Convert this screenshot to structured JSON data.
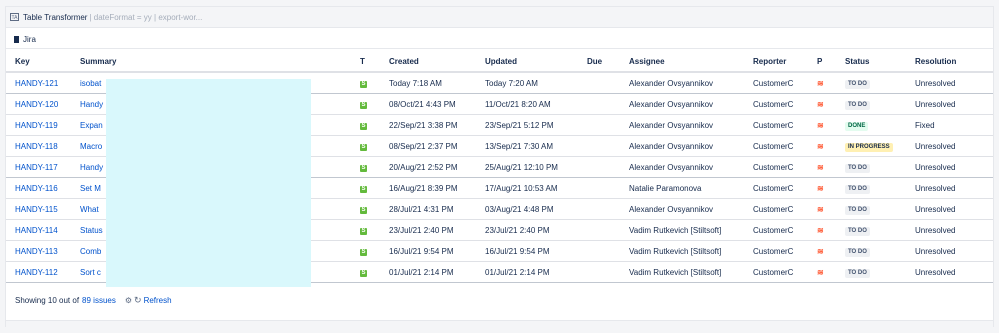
{
  "macro": {
    "icon_text": "TA",
    "title": "Table Transformer",
    "params": "| dateFormat = yy | export-wor..."
  },
  "jira_label": "Jira",
  "columns": [
    "Key",
    "Summary",
    "T",
    "Created",
    "Updated",
    "Due",
    "Assignee",
    "Reporter",
    "P",
    "Status",
    "Resolution"
  ],
  "rows": [
    {
      "key": "HANDY-121",
      "summary": "isobat",
      "type": "S",
      "created": "Today 7:18 AM",
      "updated": "Today 7:20 AM",
      "due": "",
      "assignee": "Alexander Ovsyannikov",
      "reporter": "CustomerC",
      "priority": "≋",
      "status": "TO DO",
      "resolution": "Unresolved"
    },
    {
      "key": "HANDY-120",
      "summary": "Handy",
      "type": "S",
      "created": "08/Oct/21 4:43 PM",
      "updated": "11/Oct/21 8:20 AM",
      "due": "",
      "assignee": "Alexander Ovsyannikov",
      "reporter": "CustomerC",
      "priority": "≋",
      "status": "TO DO",
      "resolution": "Unresolved"
    },
    {
      "key": "HANDY-119",
      "summary": "Expan",
      "type": "S",
      "created": "22/Sep/21 3:38 PM",
      "updated": "23/Sep/21 5:12 PM",
      "due": "",
      "assignee": "Alexander Ovsyannikov",
      "reporter": "CustomerC",
      "priority": "≋",
      "status": "DONE",
      "resolution": "Fixed"
    },
    {
      "key": "HANDY-118",
      "summary": "Macro",
      "type": "S",
      "created": "08/Sep/21 2:37 PM",
      "updated": "13/Sep/21 7:30 AM",
      "due": "",
      "assignee": "Alexander Ovsyannikov",
      "reporter": "CustomerC",
      "priority": "≋",
      "status": "IN PROGRESS",
      "resolution": "Unresolved"
    },
    {
      "key": "HANDY-117",
      "summary": "Handy",
      "type": "S",
      "created": "20/Aug/21 2:52 PM",
      "updated": "25/Aug/21 12:10 PM",
      "due": "",
      "assignee": "Alexander Ovsyannikov",
      "reporter": "CustomerC",
      "priority": "≋",
      "status": "TO DO",
      "resolution": "Unresolved"
    },
    {
      "key": "HANDY-116",
      "summary": "Set M",
      "type": "S",
      "created": "16/Aug/21 8:39 PM",
      "updated": "17/Aug/21 10:53 AM",
      "due": "",
      "assignee": "Natalie Paramonova",
      "reporter": "CustomerC",
      "priority": "≋",
      "status": "TO DO",
      "resolution": "Unresolved"
    },
    {
      "key": "HANDY-115",
      "summary": "What",
      "type": "S",
      "created": "28/Jul/21 4:31 PM",
      "updated": "03/Aug/21 4:48 PM",
      "due": "",
      "assignee": "Alexander Ovsyannikov",
      "reporter": "CustomerC",
      "priority": "≋",
      "status": "TO DO",
      "resolution": "Unresolved"
    },
    {
      "key": "HANDY-114",
      "summary": "Status",
      "type": "S",
      "created": "23/Jul/21 2:40 PM",
      "updated": "23/Jul/21 2:40 PM",
      "due": "",
      "assignee": "Vadim Rutkevich [Stiltsoft]",
      "reporter": "CustomerC",
      "priority": "≋",
      "status": "TO DO",
      "resolution": "Unresolved"
    },
    {
      "key": "HANDY-113",
      "summary": "Comb",
      "type": "S",
      "created": "16/Jul/21 9:54 PM",
      "updated": "16/Jul/21 9:54 PM",
      "due": "",
      "assignee": "Vadim Rutkevich [Stiltsoft]",
      "reporter": "CustomerC",
      "priority": "≋",
      "status": "TO DO",
      "resolution": "Unresolved"
    },
    {
      "key": "HANDY-112",
      "summary": "Sort c",
      "type": "S",
      "created": "01/Jul/21 2:14 PM",
      "updated": "01/Jul/21 2:14 PM",
      "due": "",
      "assignee": "Vadim Rutkevich [Stiltsoft]",
      "reporter": "CustomerC",
      "priority": "≋",
      "status": "TO DO",
      "resolution": "Unresolved"
    }
  ],
  "footer": {
    "showing": "Showing 10 out of",
    "count": "89 issues",
    "spinner": "⚙",
    "refresh_icon": "↻",
    "refresh": "Refresh"
  },
  "colors": {
    "link": "#0052cc",
    "story_type": "#63ba3c",
    "priority": "#ff5630",
    "redaction": "#d9f8fc"
  }
}
